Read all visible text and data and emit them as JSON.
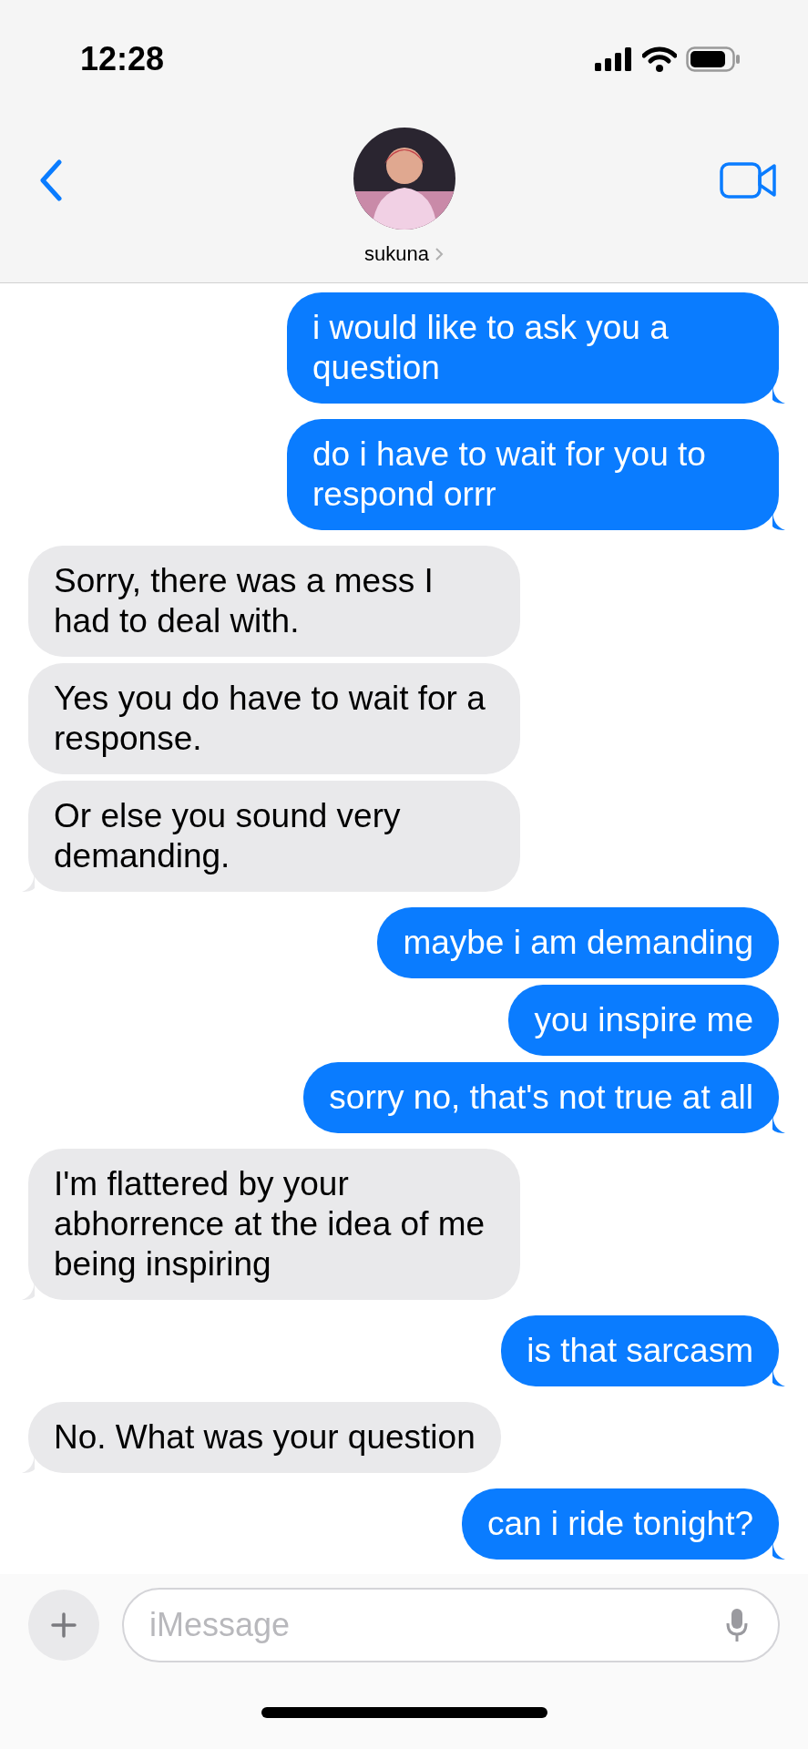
{
  "status_bar": {
    "time": "12:28"
  },
  "header": {
    "contact_name": "sukuna"
  },
  "messages": [
    {
      "kind": "sent",
      "text": "i would like to ask you a question",
      "tail": true
    },
    {
      "kind": "sent",
      "text": "do i have to wait for you to respond orrr",
      "tail": true
    },
    {
      "kind": "received",
      "text": "Sorry, there was a mess I had to deal with.",
      "tail": false
    },
    {
      "kind": "received",
      "text": "Yes you do have to wait for a response.",
      "tail": false
    },
    {
      "kind": "received",
      "text": "Or else you sound very demanding.",
      "tail": true
    },
    {
      "kind": "sent",
      "text": "maybe i am demanding",
      "tail": false
    },
    {
      "kind": "sent",
      "text": "you inspire me",
      "tail": false
    },
    {
      "kind": "sent",
      "text": "sorry no, that's not true at all",
      "tail": true
    },
    {
      "kind": "received",
      "text": "I'm flattered by your abhorrence at the idea of me being inspiring",
      "tail": true
    },
    {
      "kind": "sent",
      "text": "is that sarcasm",
      "tail": true
    },
    {
      "kind": "received",
      "text": "No. What was your question",
      "tail": true
    },
    {
      "kind": "sent",
      "text": "can i ride tonight?",
      "tail": true
    }
  ],
  "composer": {
    "placeholder": "iMessage"
  }
}
